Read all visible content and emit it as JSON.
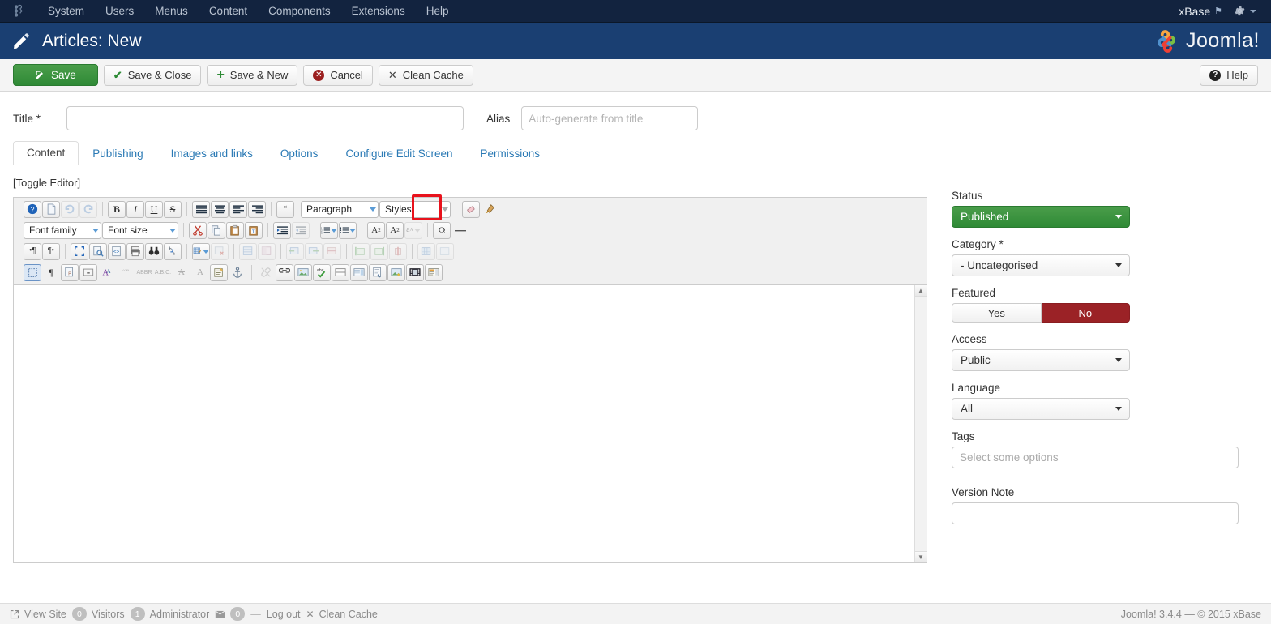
{
  "topbar": {
    "logo_icon": "joomla-logo-icon",
    "menu": [
      {
        "label": "System"
      },
      {
        "label": "Users"
      },
      {
        "label": "Menus"
      },
      {
        "label": "Content"
      },
      {
        "label": "Components"
      },
      {
        "label": "Extensions"
      },
      {
        "label": "Help"
      }
    ],
    "user": "xBase",
    "external_icon": "external-link-icon",
    "gear_icon": "gear-icon",
    "bg_color": "#12233f"
  },
  "pageheader": {
    "icon": "pencil-icon",
    "title": "Articles: New",
    "brand": "Joomla!",
    "bg_color": "#1a3f72"
  },
  "toolbar": {
    "save": "Save",
    "save_close": "Save & Close",
    "save_new": "Save & New",
    "cancel": "Cancel",
    "clean_cache": "Clean Cache",
    "help": "Help",
    "save_color": "#2f8a36"
  },
  "form": {
    "title_label": "Title *",
    "title_value": "",
    "title_placeholder": "",
    "alias_label": "Alias",
    "alias_value": "",
    "alias_placeholder": "Auto-generate from title"
  },
  "tabs": [
    {
      "label": "Content",
      "active": true
    },
    {
      "label": "Publishing",
      "active": false
    },
    {
      "label": "Images and links",
      "active": false
    },
    {
      "label": "Options",
      "active": false
    },
    {
      "label": "Configure Edit Screen",
      "active": false
    },
    {
      "label": "Permissions",
      "active": false
    }
  ],
  "editor": {
    "toggle_label": "[Toggle Editor]",
    "content": "",
    "row1": {
      "help_icon": "help-circle-icon",
      "new_doc_icon": "new-document-icon",
      "undo_icon": "undo-icon",
      "redo_icon": "redo-icon",
      "bold_icon": "bold-icon",
      "italic_icon": "italic-icon",
      "underline_icon": "underline-icon",
      "strike_icon": "strikethrough-icon",
      "align_justify_icon": "align-justify-icon",
      "align_center_icon": "align-center-icon",
      "align_left_icon": "align-left-icon",
      "align_right_icon": "align-right-icon",
      "blockquote_icon": "blockquote-icon",
      "paragraph_select": "Paragraph",
      "styles_select": "Styles",
      "eraser_icon": "eraser-icon",
      "paintbrush_icon": "paintbrush-icon"
    },
    "row2": {
      "font_family_select": "Font family",
      "font_size_select": "Font size",
      "cut_icon": "cut-scissors-icon",
      "copy_icon": "copy-icon",
      "paste_icon": "paste-icon",
      "paste_text_icon": "paste-as-text-icon",
      "indent_icon": "indent-icon",
      "outdent_icon": "outdent-icon",
      "ordered_list_icon": "ordered-list-icon",
      "unordered_list_icon": "unordered-list-icon",
      "subscript_icon": "subscript-icon",
      "superscript_icon": "superscript-icon",
      "clear_format_icon": "clear-formatting-icon",
      "special_char_icon": "special-character-icon",
      "horizontal_rule_icon": "horizontal-rule-icon"
    },
    "row3": {
      "ltr_icon": "left-to-right-icon",
      "rtl_icon": "right-to-left-icon",
      "fullscreen_icon": "fullscreen-icon",
      "preview_icon": "preview-icon",
      "source_code_icon": "source-code-icon",
      "print_icon": "print-icon",
      "search_icon": "find-binoculars-icon",
      "replace_icon": "find-replace-icon",
      "table_icon": "insert-table-icon",
      "delete_table_icon": "delete-table-icon",
      "table_props_icon": "table-properties-icon",
      "cell_props_icon": "cell-properties-icon",
      "merge_cells_icon": "merge-cells-icon",
      "split_cells_icon": "split-cells-icon",
      "row_props_icon": "row-properties-icon",
      "insert_row_before_icon": "insert-row-before-icon",
      "insert_row_after_icon": "insert-row-after-icon",
      "delete_row_icon": "delete-row-icon",
      "insert_col_icon": "insert-column-icon",
      "delete_col_icon": "delete-column-icon"
    },
    "row4": {
      "visual_aid_icon": "visual-aid-icon",
      "pilcrow_icon": "show-invisible-icon",
      "page_break_icon": "page-break-icon",
      "nonbreaking_icon": "nonbreaking-space-icon",
      "text_color_icon": "text-color-icon",
      "quote_icon": "quotation-icon",
      "abbr_icon": "abbreviation-icon",
      "acronym_icon": "acronym-icon",
      "del_icon": "deleted-text-icon",
      "ins_icon": "inserted-text-icon",
      "attributes_icon": "attributes-icon",
      "anchor_icon": "anchor-icon",
      "unlink_icon": "unlink-icon",
      "link_icon": "insert-link-icon",
      "image_icon": "insert-image-icon",
      "spellcheck_icon": "spellcheck-icon",
      "readmore_icon": "readmore-icon",
      "pagebreak2_icon": "pagebreak-icon",
      "article_link_icon": "article-link-icon",
      "media_image_icon": "media-image-icon",
      "video_icon": "video-icon",
      "module_icon": "module-icon"
    },
    "highlight": {
      "target_icon": "eraser-icon",
      "color": "#e8121c"
    }
  },
  "sidebar": {
    "status": {
      "label": "Status",
      "value": "Published",
      "color": "#2f8a36"
    },
    "category": {
      "label": "Category *",
      "value": "- Uncategorised"
    },
    "featured": {
      "label": "Featured",
      "yes": "Yes",
      "no": "No",
      "selected": "No",
      "no_color": "#9b2226"
    },
    "access": {
      "label": "Access",
      "value": "Public"
    },
    "language": {
      "label": "Language",
      "value": "All"
    },
    "tags": {
      "label": "Tags",
      "placeholder": "Select some options",
      "value": ""
    },
    "version_note": {
      "label": "Version Note",
      "value": "",
      "placeholder": ""
    }
  },
  "footer": {
    "view_site": "View Site",
    "view_site_icon": "external-link-icon",
    "visitors_count": "0",
    "visitors_label": "Visitors",
    "admin_count": "1",
    "admin_label": "Administrator",
    "mail_icon": "envelope-icon",
    "messages_count": "0",
    "logout": "Log out",
    "clean_cache_icon": "broom-icon",
    "clean_cache": "Clean Cache",
    "version": "Joomla! 3.4.4  —  © 2015 xBase"
  }
}
